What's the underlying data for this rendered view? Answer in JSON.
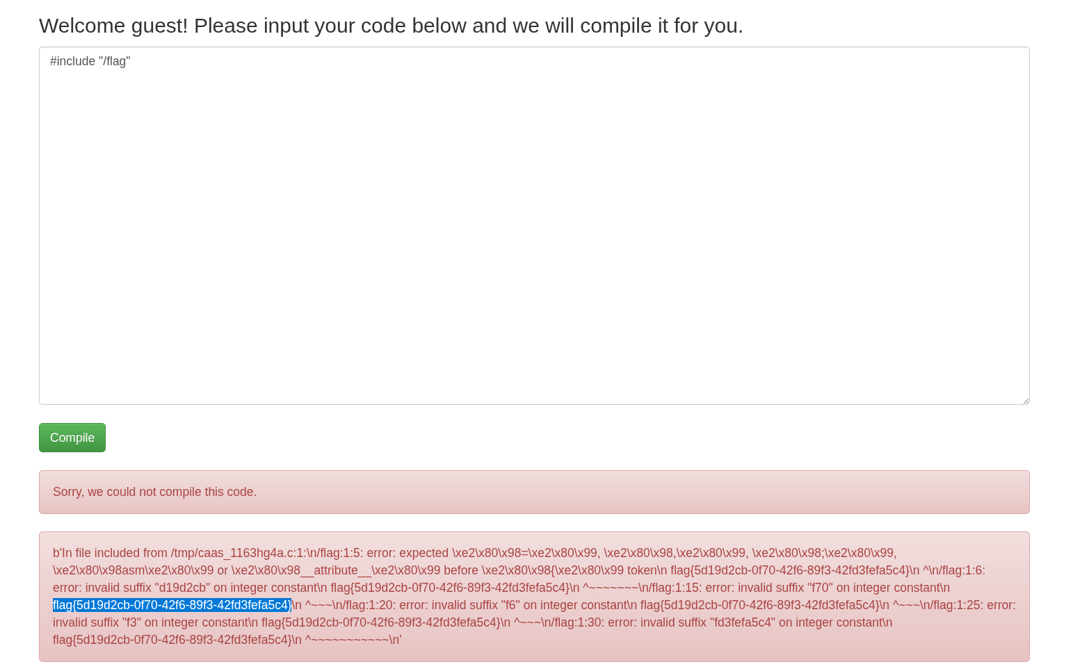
{
  "heading": "Welcome guest! Please input your code below and we will compile it for you.",
  "code_editor": {
    "value": "#include \"/flag\""
  },
  "compile_button": {
    "label": "Compile"
  },
  "alerts": [
    {
      "kind": "message",
      "text": "Sorry, we could not compile this code."
    },
    {
      "kind": "output",
      "parts": [
        {
          "text": "b'In file included from /tmp/caas_1163hg4a.c:1:\\n/flag:1:5: error: expected \\xe2\\x80\\x98=\\xe2\\x80\\x99, \\xe2\\x80\\x98,\\xe2\\x80\\x99, \\xe2\\x80\\x98;\\xe2\\x80\\x99, \\xe2\\x80\\x98asm\\xe2\\x80\\x99 or \\xe2\\x80\\x98__attribute__\\xe2\\x80\\x99 before \\xe2\\x80\\x98{\\xe2\\x80\\x99 token\\n flag{5d19d2cb-0f70-42f6-89f3-42fd3fefa5c4}\\n ^\\n/flag:1:6: error: invalid suffix \"d19d2cb\" on integer constant\\n flag{5d19d2cb-0f70-42f6-89f3-42fd3fefa5c4}\\n ^~~~~~~~\\n/flag:1:15: error: invalid suffix \"f70\" on integer constant\\n ",
          "selected": false
        },
        {
          "text": "flag{5d19d2cb-0f70-42f6-89f3-42fd3fefa5c4}",
          "selected": true
        },
        {
          "text": "\\n ^~~~\\n/flag:1:20: error: invalid suffix \"f6\" on integer constant\\n flag{5d19d2cb-0f70-42f6-89f3-42fd3fefa5c4}\\n ^~~~\\n/flag:1:25: error: invalid suffix \"f3\" on integer constant\\n flag{5d19d2cb-0f70-42f6-89f3-42fd3fefa5c4}\\n ^~~~\\n/flag:1:30: error: invalid suffix \"fd3fefa5c4\" on integer constant\\n flag{5d19d2cb-0f70-42f6-89f3-42fd3fefa5c4}\\n ^~~~~~~~~~~~\\n'",
          "selected": false
        }
      ]
    }
  ]
}
